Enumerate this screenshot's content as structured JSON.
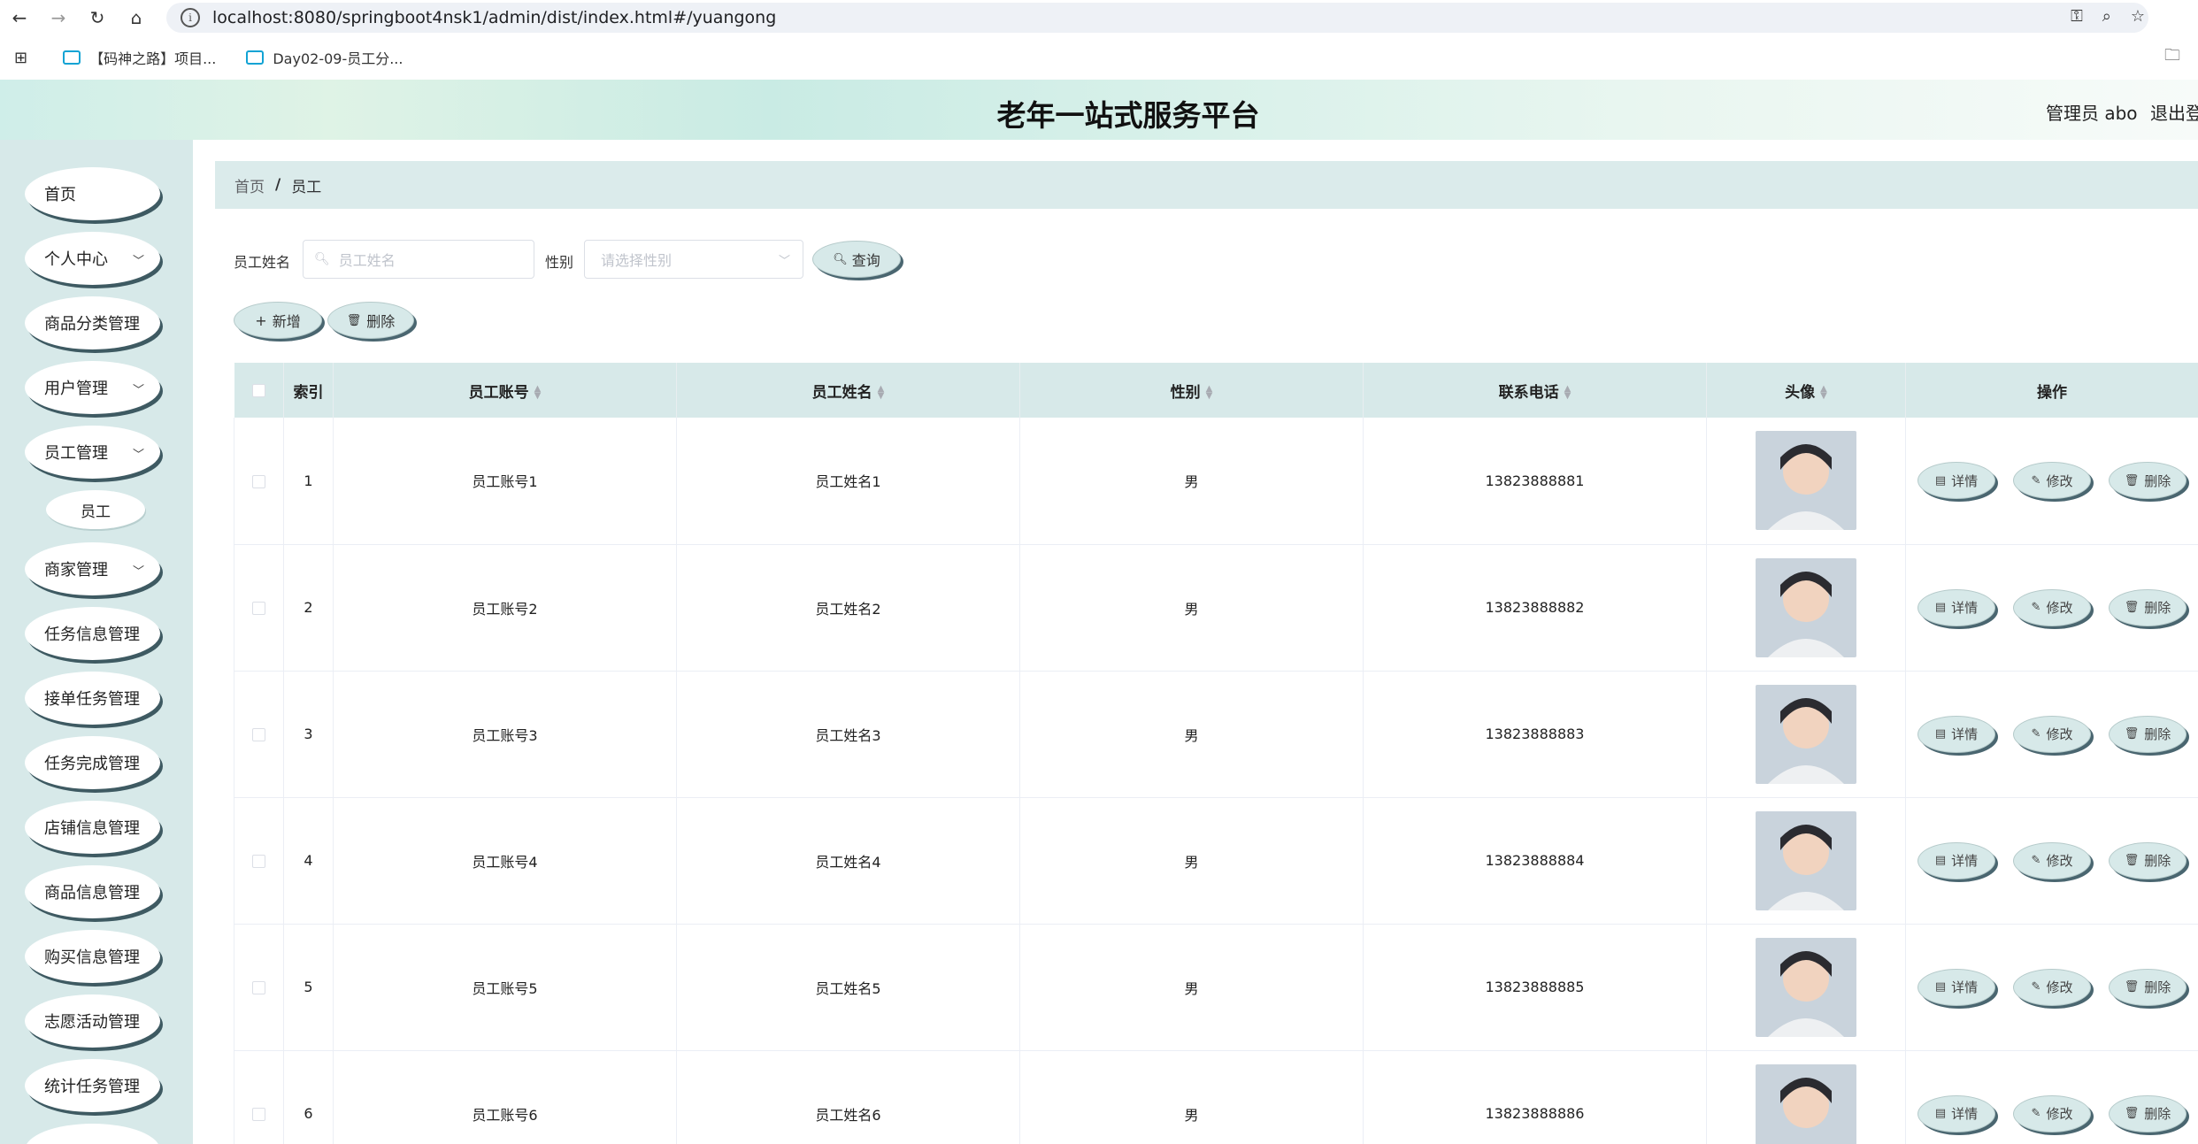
{
  "browser": {
    "url": "localhost:8080/springboot4nsk1/admin/dist/index.html#/yuangong",
    "bookmarks": [
      "【码神之路】项目...",
      "Day02-09-员工分..."
    ]
  },
  "header": {
    "title": "老年一站式服务平台",
    "user": "管理员 abo",
    "logout": "退出登录"
  },
  "sidebar": {
    "items": [
      {
        "label": "首页",
        "chevron": false
      },
      {
        "label": "个人中心",
        "chevron": true
      },
      {
        "label": "商品分类管理",
        "chevron": false
      },
      {
        "label": "用户管理",
        "chevron": true
      },
      {
        "label": "员工管理",
        "chevron": true
      },
      {
        "label": "商家管理",
        "chevron": true
      },
      {
        "label": "任务信息管理",
        "chevron": false
      },
      {
        "label": "接单任务管理",
        "chevron": false
      },
      {
        "label": "任务完成管理",
        "chevron": false
      },
      {
        "label": "店铺信息管理",
        "chevron": false
      },
      {
        "label": "商品信息管理",
        "chevron": false
      },
      {
        "label": "购买信息管理",
        "chevron": false
      },
      {
        "label": "志愿活动管理",
        "chevron": false
      },
      {
        "label": "统计任务管理",
        "chevron": false
      }
    ],
    "sub_item": "员工"
  },
  "breadcrumb": {
    "home": "首页",
    "separator": "/",
    "current": "员工"
  },
  "search": {
    "name_label": "员工姓名",
    "name_placeholder": "员工姓名",
    "gender_label": "性别",
    "gender_placeholder": "请选择性别",
    "query_button": "查询"
  },
  "actions": {
    "add": "新增",
    "delete": "删除"
  },
  "table": {
    "columns": [
      "索引",
      "员工账号",
      "员工姓名",
      "性别",
      "联系电话",
      "头像",
      "操作"
    ],
    "rows": [
      {
        "index": "1",
        "account": "员工账号1",
        "name": "员工姓名1",
        "gender": "男",
        "phone": "13823888881"
      },
      {
        "index": "2",
        "account": "员工账号2",
        "name": "员工姓名2",
        "gender": "男",
        "phone": "13823888882"
      },
      {
        "index": "3",
        "account": "员工账号3",
        "name": "员工姓名3",
        "gender": "男",
        "phone": "13823888883"
      },
      {
        "index": "4",
        "account": "员工账号4",
        "name": "员工姓名4",
        "gender": "男",
        "phone": "13823888884"
      },
      {
        "index": "5",
        "account": "员工账号5",
        "name": "员工姓名5",
        "gender": "男",
        "phone": "13823888885"
      },
      {
        "index": "6",
        "account": "员工账号6",
        "name": "员工姓名6",
        "gender": "男",
        "phone": "13823888886"
      }
    ],
    "row_actions": {
      "detail": "详情",
      "edit": "修改",
      "delete": "删除"
    }
  },
  "colors": {
    "accent": "#d7e9e9",
    "shadow": "#4a6670",
    "sidebar_bg": "#d7e9e9"
  }
}
